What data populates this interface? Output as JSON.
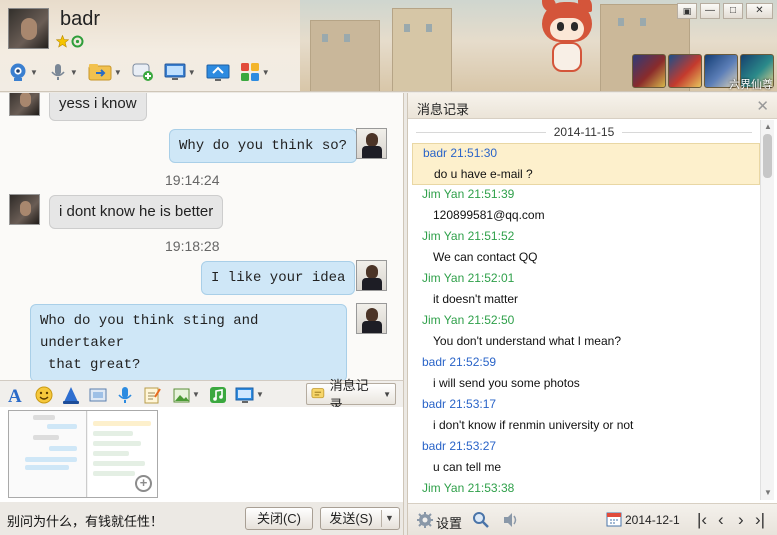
{
  "contact": {
    "name": "badr"
  },
  "window": {
    "minimize": "—",
    "restore": "□",
    "close": "✕"
  },
  "badges": {
    "caption": "六界仙尊"
  },
  "chat": {
    "messages": [
      {
        "side": "in",
        "text": "yess i know"
      },
      {
        "side": "out",
        "text": "Why do you think so?"
      },
      {
        "side": "time",
        "text": "19:14:24"
      },
      {
        "side": "in",
        "text": "i dont know he is better"
      },
      {
        "side": "time",
        "text": "19:18:28"
      },
      {
        "side": "out",
        "text": "I like your idea"
      },
      {
        "side": "out",
        "text": "Who do you think sting and undertaker that great?"
      }
    ],
    "msg_line1": "Who do you think sting and undertaker",
    "msg_line2": "that great?"
  },
  "input_toolbar": {
    "history_button": "消息记录"
  },
  "bottom_bar": {
    "signature": "别问为什么，有钱就任性！",
    "close_label": "关闭(C)",
    "send_label": "发送(S)"
  },
  "history": {
    "title": "消息记录",
    "date": "2014-11-15",
    "entries": [
      {
        "header": "badr 21:51:30",
        "message": "do u have e-mail ?",
        "selected": true
      },
      {
        "header": "Jim Yan 21:51:39",
        "message": "120899581@qq.com"
      },
      {
        "header": "Jim Yan 21:51:52",
        "message": "We can contact QQ"
      },
      {
        "header": "Jim Yan 21:52:01",
        "message": "it doesn't matter"
      },
      {
        "header": "Jim Yan 21:52:50",
        "message": "You don't understand what I mean?"
      },
      {
        "header": "badr 21:52:59",
        "message": "i will send you some photos"
      },
      {
        "header": "badr 21:53:17",
        "message": "i don't know if renmin university or not"
      },
      {
        "header": "badr 21:53:27",
        "message": "u can tell me"
      },
      {
        "header": "Jim Yan 21:53:38",
        "message": ""
      }
    ],
    "footer": {
      "settings_label": "设置",
      "date": "2014-12-1"
    }
  },
  "colors": {
    "badr": "#2a64c8",
    "jim": "#2fa04a",
    "bubble_out": "#cfe7f7",
    "bubble_in": "#e6e6e6",
    "selected_row": "#fdf0cc"
  }
}
